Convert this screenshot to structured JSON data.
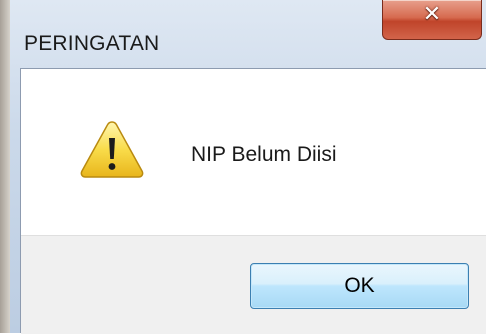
{
  "dialog": {
    "title": "PERINGATAN",
    "close_glyph": "✕",
    "message": "NIP Belum Diisi",
    "icon": "warning-icon",
    "ok_label": "OK"
  },
  "colors": {
    "close_button": "#c74a30",
    "ok_button_border": "#3c7fb1",
    "warning_yellow": "#f7d23a"
  }
}
